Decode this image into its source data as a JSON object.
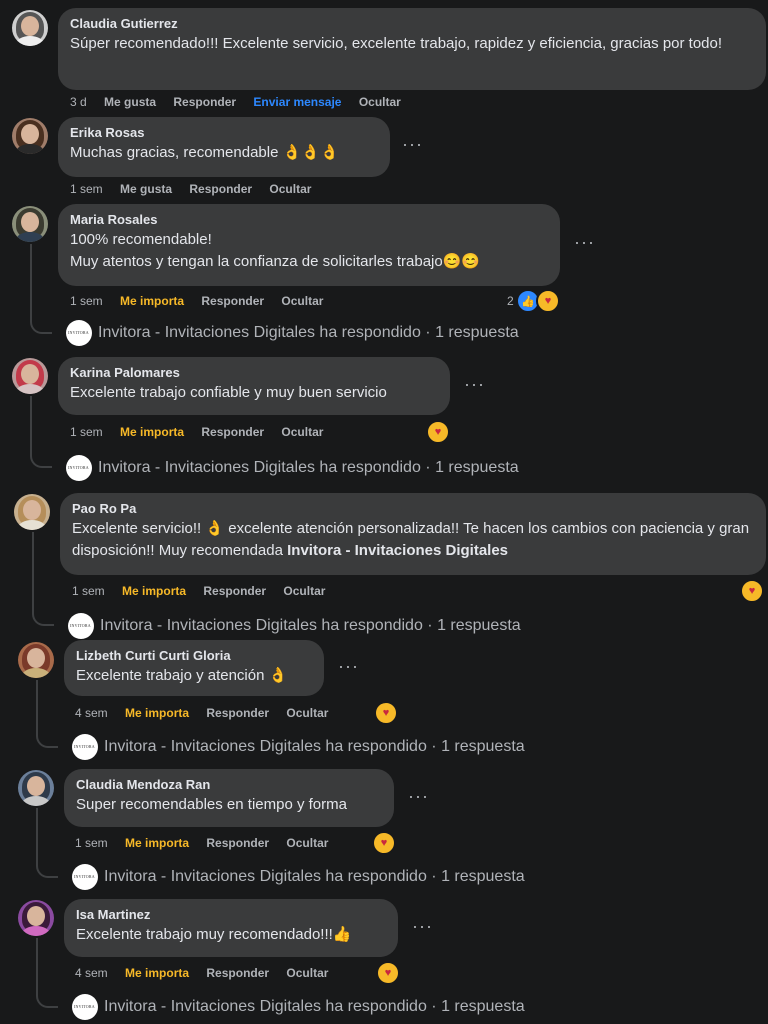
{
  "comments": [
    {
      "name": "Claudia Gutierrez",
      "text": "Súper recomendado!!! Excelente servicio, excelente trabajo, rapidez y eficiencia, gracias por todo!",
      "time": "3 d",
      "like": "Me gusta",
      "reply": "Responder",
      "message": "Enviar mensaje",
      "hide": "Ocultar"
    },
    {
      "name": "Erika Rosas",
      "text": "Muchas gracias, recomendable 👌👌👌",
      "time": "1 sem",
      "like": "Me gusta",
      "reply": "Responder",
      "hide": "Ocultar"
    },
    {
      "name": "Maria Rosales",
      "text_line1": "100% recomendable!",
      "text_line2": "Muy atentos y tengan la confianza de solicitarles trabajo😊😊",
      "time": "1 sem",
      "like": "Me importa",
      "reply": "Responder",
      "hide": "Ocultar",
      "reaction_count": "2",
      "reply_summary": "Invitora - Invitaciones Digitales ha respondido · 1 respuesta"
    },
    {
      "name": "Karina Palomares",
      "text": "Excelente trabajo confiable y muy buen servicio",
      "time": "1 sem",
      "like": "Me importa",
      "reply": "Responder",
      "hide": "Ocultar",
      "reply_summary": "Invitora - Invitaciones Digitales ha respondido · 1 respuesta"
    },
    {
      "name": "Pao Ro Pa",
      "text_a": "Excelente servicio!! 👌 excelente atención personalizada!! Te hacen los cambios con paciencia y gran disposición!! Muy recomendada ",
      "text_tag": "Invitora - Invitaciones Digitales",
      "time": "1 sem",
      "like": "Me importa",
      "reply": "Responder",
      "hide": "Ocultar",
      "reply_summary": "Invitora - Invitaciones Digitales ha respondido · 1 respuesta"
    },
    {
      "name": "Lizbeth Curti Curti Gloria",
      "text": "Excelente trabajo y atención 👌",
      "time": "4 sem",
      "like": "Me importa",
      "reply": "Responder",
      "hide": "Ocultar",
      "reply_summary": "Invitora - Invitaciones Digitales ha respondido · 1 respuesta"
    },
    {
      "name": "Claudia Mendoza Ran",
      "text": "Super recomendables en tiempo y forma",
      "time": "1 sem",
      "like": "Me importa",
      "reply": "Responder",
      "hide": "Ocultar",
      "reply_summary": "Invitora - Invitaciones Digitales ha respondido · 1 respuesta"
    },
    {
      "name": "Isa Martinez",
      "text": "Excelente trabajo muy recomendado!!!👍",
      "time": "4 sem",
      "like": "Me importa",
      "reply": "Responder",
      "hide": "Ocultar",
      "reply_summary": "Invitora - Invitaciones Digitales ha respondido · 1 respuesta"
    }
  ],
  "more_options": "···",
  "reaction_icons": {
    "care": "care-reaction-icon",
    "like": "like-reaction-icon"
  },
  "colors": {
    "background": "#18191a",
    "bubble": "#3a3b3c",
    "reacted": "#f7b928",
    "link": "#2d88ff"
  }
}
